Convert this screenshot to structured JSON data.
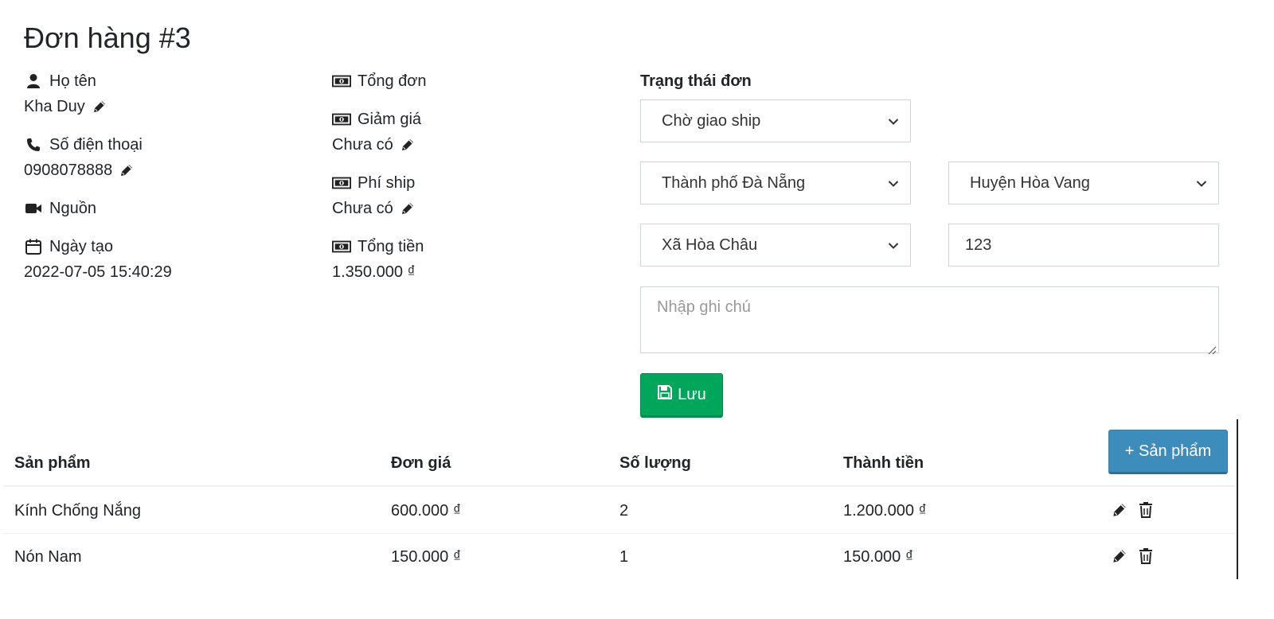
{
  "order": {
    "title": "Đơn hàng #3"
  },
  "customer": {
    "name_label": "Họ tên",
    "name_value": "Kha Duy",
    "phone_label": "Số điện thoại",
    "phone_value": "0908078888",
    "source_label": "Nguồn",
    "created_label": "Ngày tạo",
    "created_value": "2022-07-05 15:40:29"
  },
  "totals": {
    "order_total_label": "Tổng đơn",
    "discount_label": "Giảm giá",
    "discount_value": "Chưa có",
    "shipping_label": "Phí ship",
    "shipping_value": "Chưa có",
    "grand_total_label": "Tổng tiền",
    "grand_total_value": "1.350.000 ₫"
  },
  "form": {
    "status_label": "Trạng thái đơn",
    "status_selected": "Chờ giao ship",
    "city_selected": "Thành phố Đà Nẵng",
    "district_selected": "Huyện Hòa Vang",
    "ward_selected": "Xã Hòa Châu",
    "address_value": "123",
    "note_placeholder": "Nhập ghi chú",
    "save_label": "Lưu"
  },
  "products": {
    "add_label": "+ Sản phẩm",
    "columns": [
      "Sản phẩm",
      "Đơn giá",
      "Số lượng",
      "Thành tiền"
    ],
    "rows": [
      {
        "name": "Kính Chống Nắng",
        "price": "600.000 ₫",
        "qty": "2",
        "total": "1.200.000 ₫"
      },
      {
        "name": "Nón Nam",
        "price": "150.000 ₫",
        "qty": "1",
        "total": "150.000 ₫"
      }
    ]
  },
  "icons": {
    "user": "user-icon",
    "phone": "phone-icon",
    "video": "video-camera-icon",
    "calendar": "calendar-icon",
    "money": "money-bill-icon",
    "pencil": "pencil-icon",
    "trash": "trash-icon",
    "save": "floppy-disk-icon",
    "chevron": "chevron-down-icon"
  },
  "colors": {
    "save_button": "#00a65a",
    "add_button": "#3c8dbc",
    "text": "#212529"
  }
}
